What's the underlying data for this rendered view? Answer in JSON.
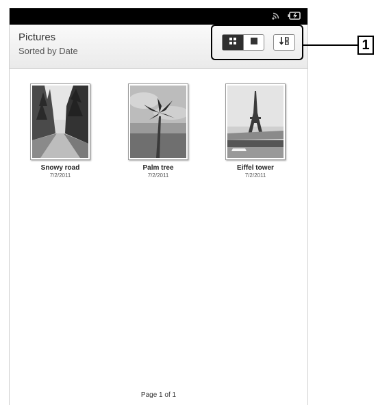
{
  "status_bar": {
    "icons": [
      "wifi-icon",
      "battery-charging-icon"
    ]
  },
  "header": {
    "title": "Pictures",
    "subtitle": "Sorted by Date"
  },
  "toolbar": {
    "view_buttons": [
      {
        "icon": "thumbnail-grid-icon",
        "active": true
      },
      {
        "icon": "list-view-icon",
        "active": false
      }
    ],
    "sort_icon": "sort-order-icon"
  },
  "callout": {
    "label": "1"
  },
  "pictures": [
    {
      "title": "Snowy road",
      "date": "7/2/2011"
    },
    {
      "title": "Palm tree",
      "date": "7/2/2011"
    },
    {
      "title": "Eiffel tower",
      "date": "7/2/2011"
    }
  ],
  "footer": {
    "page_label": "Page 1 of 1"
  }
}
